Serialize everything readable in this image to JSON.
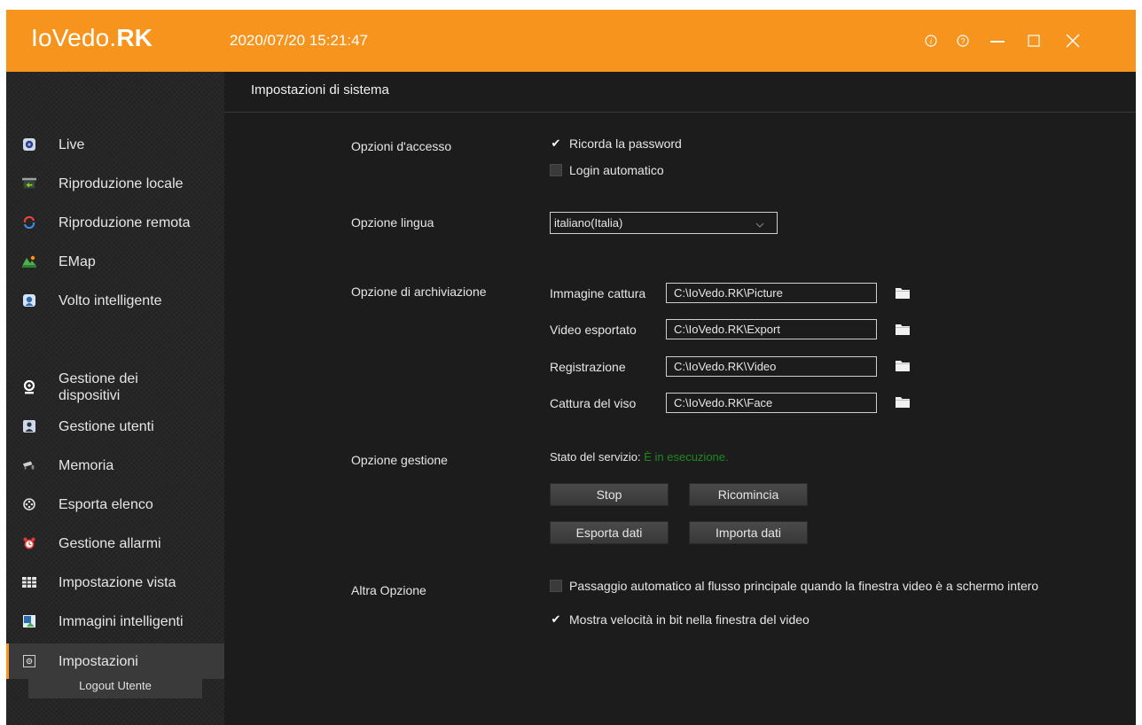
{
  "app": {
    "logo_light": "IoVedo.",
    "logo_bold": "RK",
    "datetime": "2020/07/20 15:21:47"
  },
  "colors": {
    "accent": "#f7941d",
    "running": "#1e8a1e"
  },
  "window_controls": [
    "info-icon",
    "help-icon",
    "minimize-icon",
    "maximize-icon",
    "close-icon"
  ],
  "sidebar": {
    "items": [
      {
        "label": "Live",
        "icon": "live-icon"
      },
      {
        "label": "Riproduzione locale",
        "icon": "local-playback-icon"
      },
      {
        "label": "Riproduzione remota",
        "icon": "remote-playback-icon"
      },
      {
        "label": "EMap",
        "icon": "map-icon"
      },
      {
        "label": "Volto intelligente",
        "icon": "face-icon"
      },
      {
        "label": "Gestione dei dispositivi",
        "icon": "camera-icon"
      },
      {
        "label": "Gestione utenti",
        "icon": "user-icon"
      },
      {
        "label": "Memoria",
        "icon": "memory-icon"
      },
      {
        "label": "Esporta elenco",
        "icon": "film-icon"
      },
      {
        "label": "Gestione allarmi",
        "icon": "alarm-icon"
      },
      {
        "label": "Impostazione vista",
        "icon": "grid-icon"
      },
      {
        "label": "Immagini intelligenti",
        "icon": "image-icon"
      },
      {
        "label": "Impostazioni",
        "icon": "settings-icon",
        "active": true
      }
    ],
    "logout_label": "Logout Utente"
  },
  "main": {
    "title": "Impostazioni di sistema",
    "access": {
      "label": "Opzioni d'accesso",
      "remember_password": {
        "label": "Ricorda la password",
        "checked": true
      },
      "auto_login": {
        "label": "Login automatico",
        "checked": false
      }
    },
    "language": {
      "label": "Opzione lingua",
      "selected": "italiano(Italia)"
    },
    "storage": {
      "label": "Opzione di archiviazione",
      "rows": [
        {
          "label": "Immagine cattura",
          "value": "C:\\IoVedo.RK\\Picture"
        },
        {
          "label": "Video esportato",
          "value": "C:\\IoVedo.RK\\Export"
        },
        {
          "label": "Registrazione",
          "value": "C:\\IoVedo.RK\\Video"
        },
        {
          "label": "Cattura del viso",
          "value": "C:\\IoVedo.RK\\Face"
        }
      ]
    },
    "management": {
      "label": "Opzione gestione",
      "status_label": "Stato del servizio:",
      "status_value": "È in esecuzione.",
      "stop": "Stop",
      "restart": "Ricomincia",
      "export": "Esporta dati",
      "import": "Importa dati"
    },
    "other": {
      "label": "Altra Opzione",
      "auto_switch": {
        "label": "Passaggio automatico al flusso principale quando la finestra video è a schermo intero",
        "checked": false
      },
      "show_bitrate": {
        "label": "Mostra velocità in bit nella finestra del video",
        "checked": true
      }
    }
  }
}
